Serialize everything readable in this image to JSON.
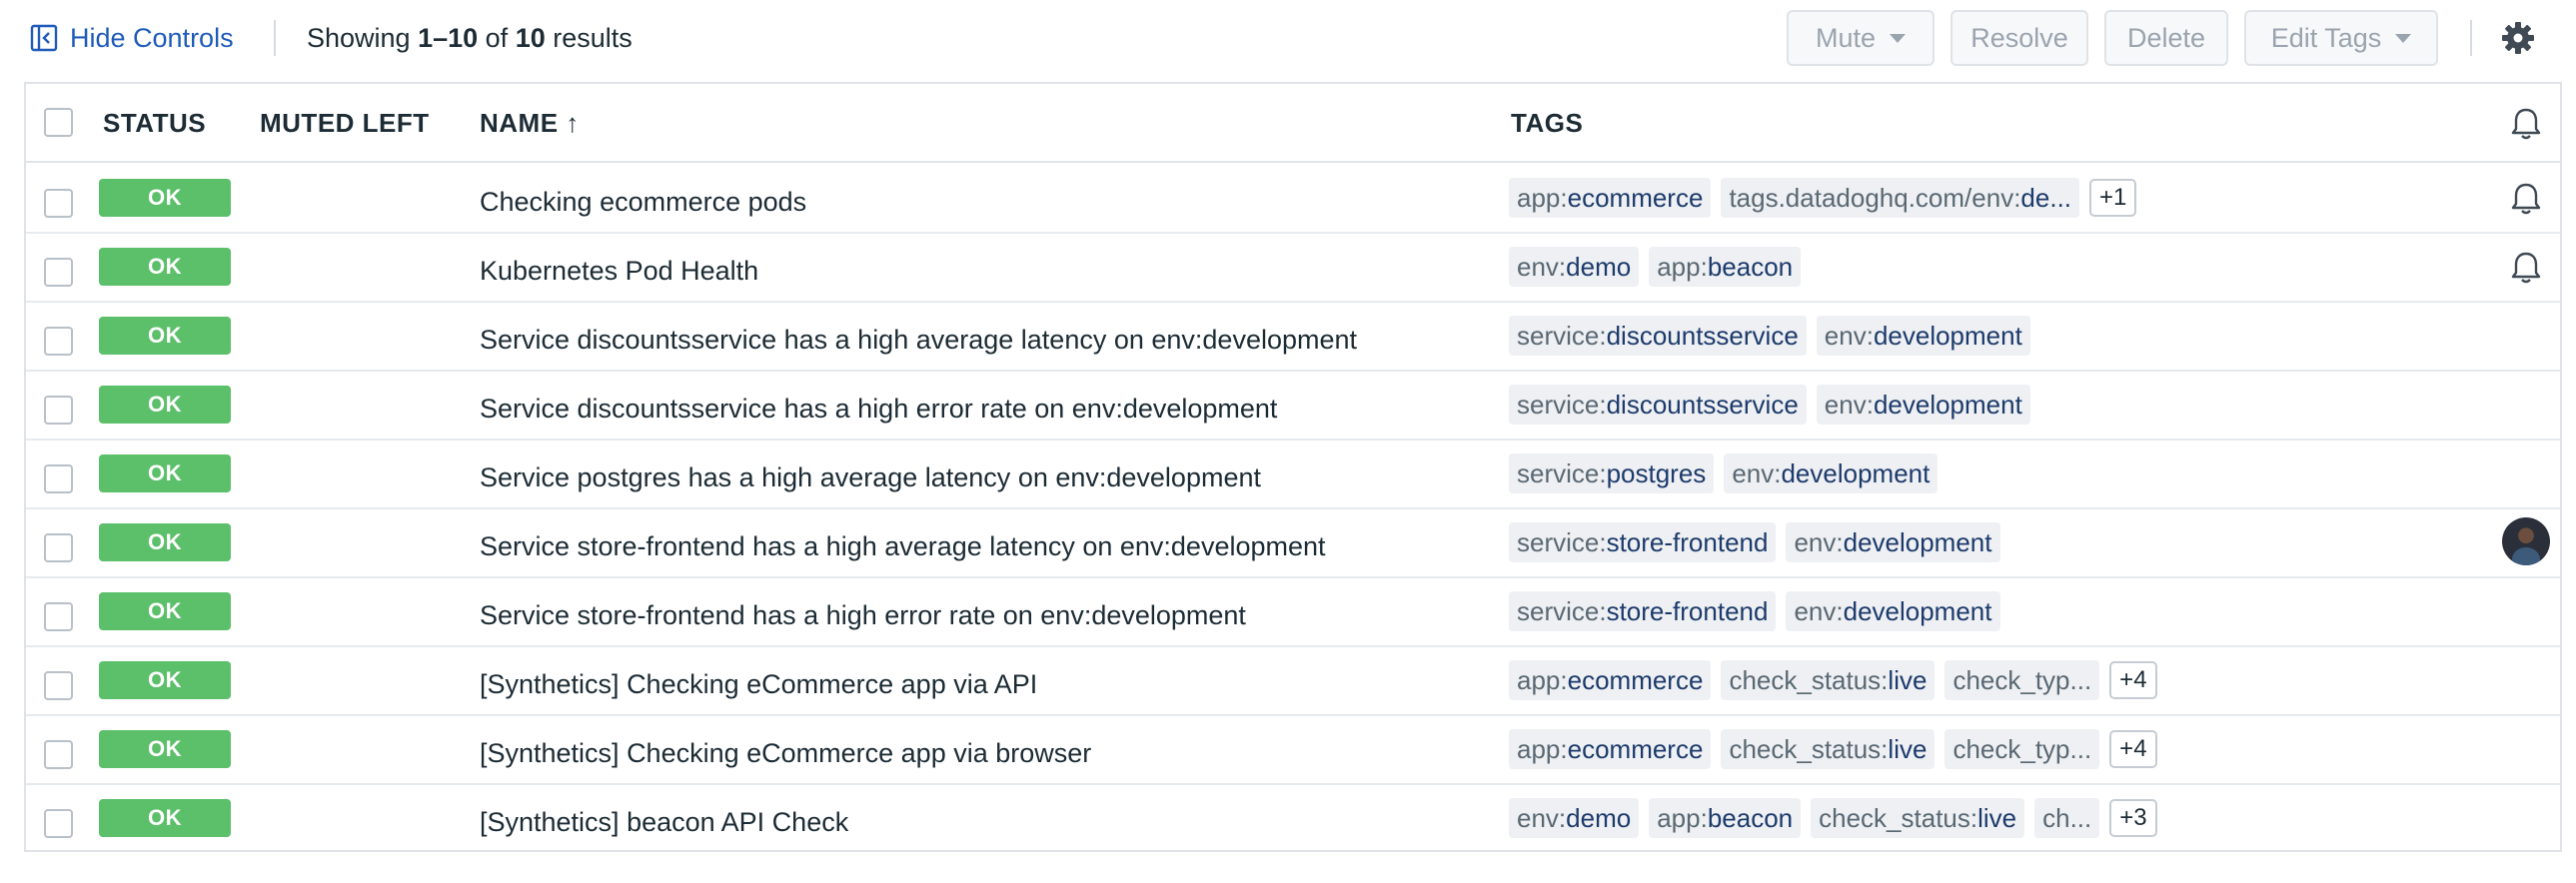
{
  "toolbar": {
    "hide_controls_label": "Hide Controls",
    "showing_prefix": "Showing ",
    "showing_range": "1–10",
    "showing_of": " of ",
    "showing_total": "10",
    "showing_suffix": " results",
    "mute_label": "Mute",
    "resolve_label": "Resolve",
    "delete_label": "Delete",
    "edit_tags_label": "Edit Tags",
    "settings_icon": "gear-icon"
  },
  "columns": {
    "status": "STATUS",
    "muted_left": "MUTED LEFT",
    "name": "NAME ↑",
    "tags": "TAGS",
    "notify_icon": "bell-icon"
  },
  "colors": {
    "ok_green": "#5cbf6a",
    "link_blue": "#1e5bb8",
    "tag_bg": "#eef0f3"
  },
  "rows": [
    {
      "status": "OK",
      "muted_left": "",
      "name": "Checking ecommerce pods",
      "tags": [
        {
          "key": "app:",
          "value": "ecommerce"
        },
        {
          "key": "tags.datadoghq.com/env:",
          "value": "de..."
        }
      ],
      "more": "+1",
      "right_icon": "bell-icon"
    },
    {
      "status": "OK",
      "muted_left": "",
      "name": "Kubernetes Pod Health",
      "tags": [
        {
          "key": "env:",
          "value": "demo"
        },
        {
          "key": "app:",
          "value": "beacon"
        }
      ],
      "more": "",
      "right_icon": "bell-icon"
    },
    {
      "status": "OK",
      "muted_left": "",
      "name": "Service discountsservice has a high average latency on env:development",
      "tags": [
        {
          "key": "service:",
          "value": "discountsservice"
        },
        {
          "key": "env:",
          "value": "development"
        }
      ],
      "more": "",
      "right_icon": ""
    },
    {
      "status": "OK",
      "muted_left": "",
      "name": "Service discountsservice has a high error rate on env:development",
      "tags": [
        {
          "key": "service:",
          "value": "discountsservice"
        },
        {
          "key": "env:",
          "value": "development"
        }
      ],
      "more": "",
      "right_icon": ""
    },
    {
      "status": "OK",
      "muted_left": "",
      "name": "Service postgres has a high average latency on env:development",
      "tags": [
        {
          "key": "service:",
          "value": "postgres"
        },
        {
          "key": "env:",
          "value": "development"
        }
      ],
      "more": "",
      "right_icon": ""
    },
    {
      "status": "OK",
      "muted_left": "",
      "name": "Service store-frontend has a high average latency on env:development",
      "tags": [
        {
          "key": "service:",
          "value": "store-frontend"
        },
        {
          "key": "env:",
          "value": "development"
        }
      ],
      "more": "",
      "right_icon": "avatar"
    },
    {
      "status": "OK",
      "muted_left": "",
      "name": "Service store-frontend has a high error rate on env:development",
      "tags": [
        {
          "key": "service:",
          "value": "store-frontend"
        },
        {
          "key": "env:",
          "value": "development"
        }
      ],
      "more": "",
      "right_icon": ""
    },
    {
      "status": "OK",
      "muted_left": "",
      "name": "[Synthetics] Checking eCommerce app via API",
      "tags": [
        {
          "key": "app:",
          "value": "ecommerce"
        },
        {
          "key": "check_status:",
          "value": "live"
        },
        {
          "key": "check_typ...",
          "value": ""
        }
      ],
      "more": "+4",
      "right_icon": ""
    },
    {
      "status": "OK",
      "muted_left": "",
      "name": "[Synthetics] Checking eCommerce app via browser",
      "tags": [
        {
          "key": "app:",
          "value": "ecommerce"
        },
        {
          "key": "check_status:",
          "value": "live"
        },
        {
          "key": "check_typ...",
          "value": ""
        }
      ],
      "more": "+4",
      "right_icon": ""
    },
    {
      "status": "OK",
      "muted_left": "",
      "name": "[Synthetics] beacon API Check",
      "tags": [
        {
          "key": "env:",
          "value": "demo"
        },
        {
          "key": "app:",
          "value": "beacon"
        },
        {
          "key": "check_status:",
          "value": "live"
        },
        {
          "key": "ch...",
          "value": ""
        }
      ],
      "more": "+3",
      "right_icon": ""
    }
  ]
}
